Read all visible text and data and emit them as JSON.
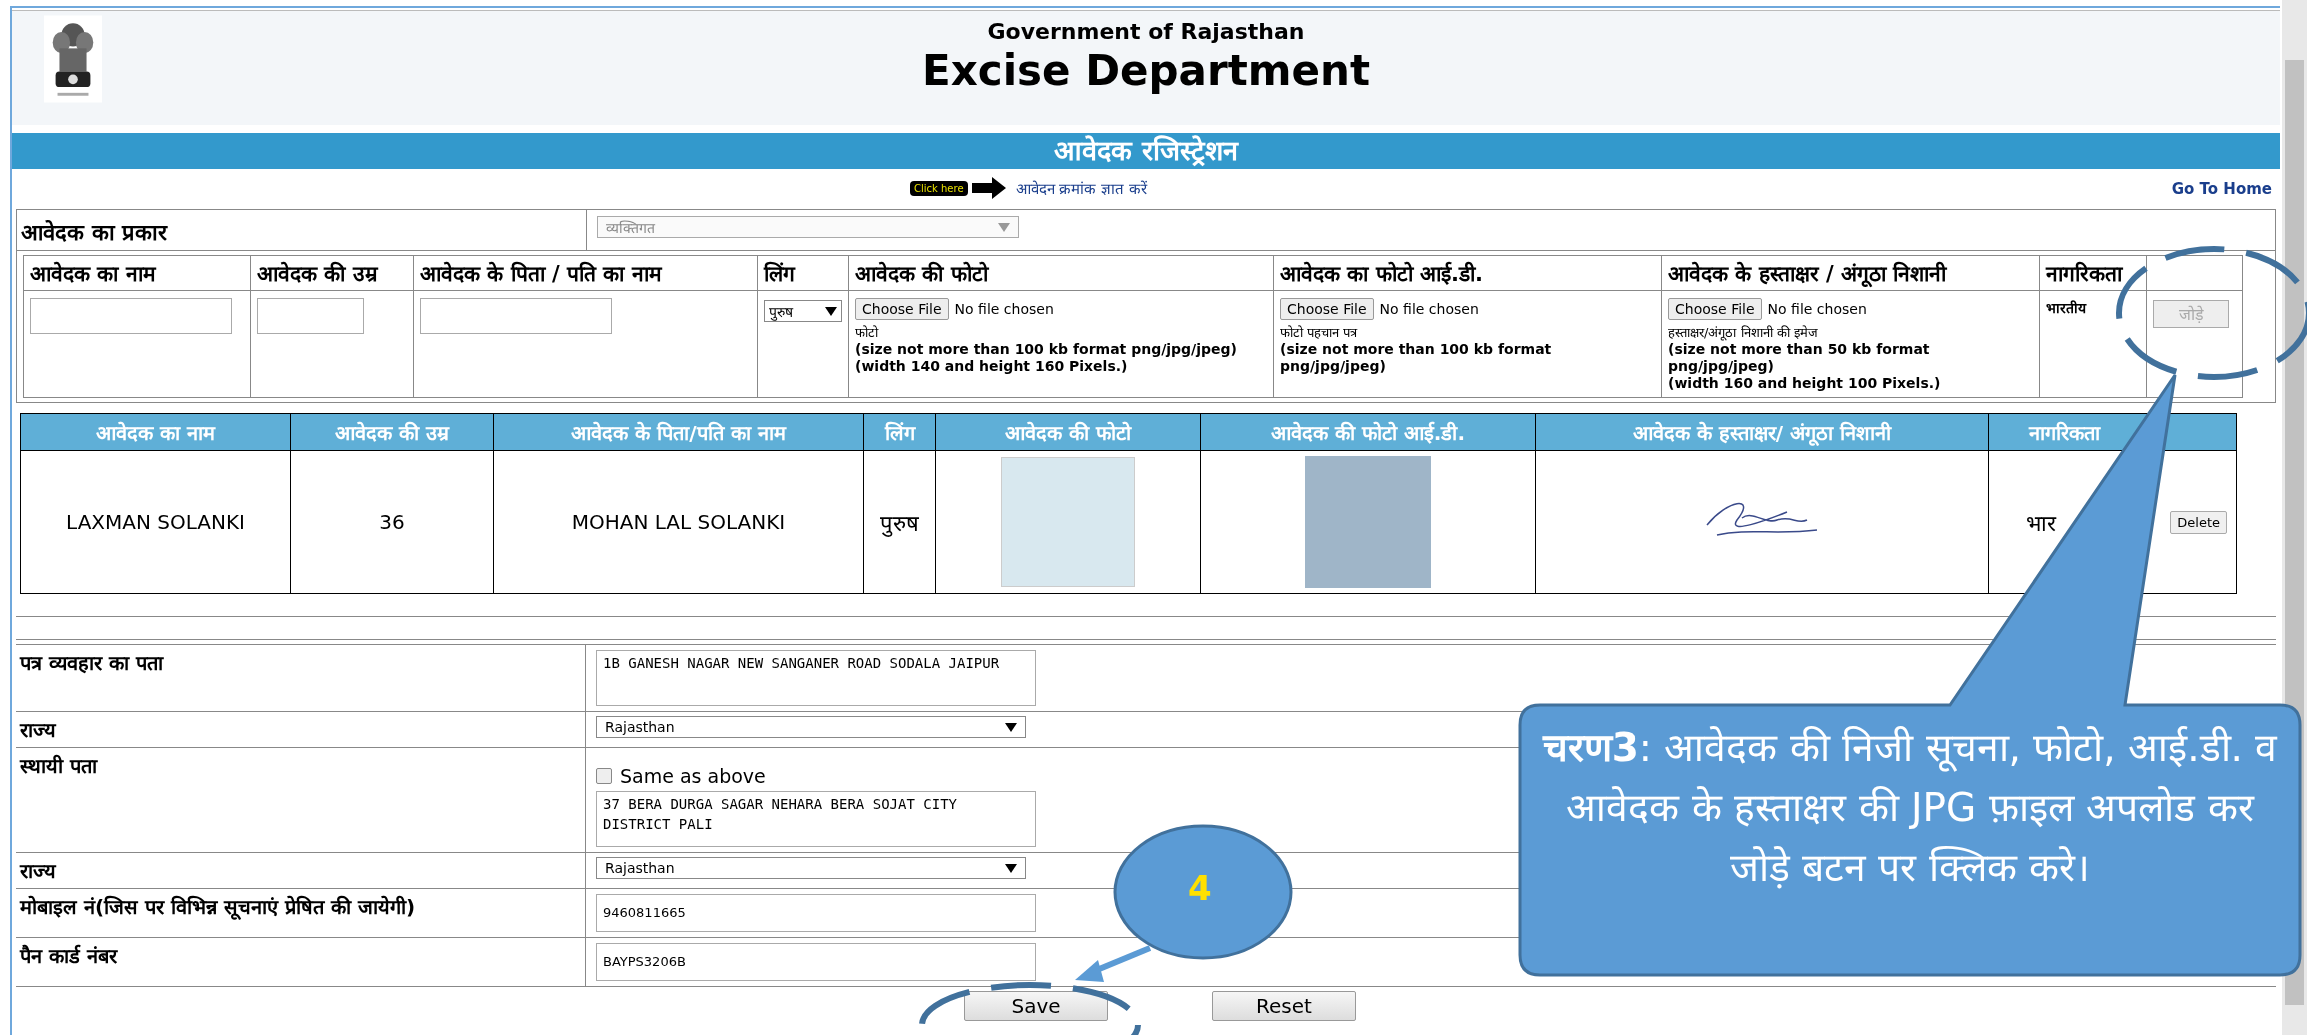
{
  "header": {
    "subtitle": "Government of Rajasthan",
    "title": "Excise Department"
  },
  "banner": "आवेदक रजिस्ट्रेशन",
  "links": {
    "click_badge": "Click here",
    "find_application": "आवेदन क्रमांक ज्ञात करें",
    "home": "Go To Home"
  },
  "applicant_type": {
    "label": "आवेदक का प्रकार",
    "value": "व्यक्तिगत",
    "disabled": true
  },
  "entry": {
    "columns": [
      "आवेदक का नाम",
      "आवेदक की उम्र",
      "आवेदक के पिता / पति का नाम",
      "लिंग",
      "आवेदक की फोटो",
      "आवेदक का फोटो आई.डी.",
      "आवेदक के हस्ताक्षर / अंगूठा निशानी",
      "नागरिकता"
    ],
    "gender": "पुरुष",
    "files": [
      {
        "button": "Choose File",
        "status": "No file chosen",
        "caption": "फोटो",
        "notes": [
          "(size not more than 100 kb format png/jpg/jpeg)",
          "(width 140 and height 160 Pixels.)"
        ]
      },
      {
        "button": "Choose File",
        "status": "No file chosen",
        "caption": "फोटो पहचान पत्र",
        "notes": [
          "(size not more than 100 kb format png/jpg/jpeg)"
        ]
      },
      {
        "button": "Choose File",
        "status": "No file chosen",
        "caption": "हस्ताक्षर/अंगूठा निशानी की इमेज",
        "notes": [
          "(size not more than 50 kb format png/jpg/jpeg)",
          "(width 160 and height 100 Pixels.)"
        ]
      }
    ],
    "citizenship": "भारतीय",
    "add_button": {
      "label": "जोड़े",
      "disabled": true
    }
  },
  "applicants": {
    "columns": [
      "आवेदक का नाम",
      "आवेदक की उम्र",
      "आवेदक के पिता/पति का नाम",
      "लिंग",
      "आवेदक की फोटो",
      "आवेदक की फोटो आई.डी.",
      "आवेदक के हस्ताक्षर/ अंगूठा निशानी",
      "नागरिकता"
    ],
    "rows": [
      {
        "name": "LAXMAN SOLANKI",
        "age": "36",
        "father": "MOHAN LAL SOLANKI",
        "gender": "पुरुष",
        "citizenship": "भार",
        "action": "Delete"
      }
    ]
  },
  "address_fields": [
    {
      "kind": "textarea",
      "label": "पत्र व्यवहार का पता",
      "value": "1B GANESH NAGAR NEW SANGANER ROAD SODALA JAIPUR"
    },
    {
      "kind": "select",
      "label": "राज्य",
      "value": "Rajasthan"
    },
    {
      "kind": "textarea",
      "label": "स्थायी पता",
      "checkbox": {
        "label": "Same as above",
        "checked": false
      },
      "value": "37 BERA DURGA SAGAR NEHARA BERA SOJAT CITY DISTRICT PALI"
    },
    {
      "kind": "select",
      "label": "राज्य",
      "value": "Rajasthan"
    },
    {
      "kind": "input",
      "label": "मोबाइल नं(जिस पर विभिन्न सूचनाएं प्रेषित की जायेगी)",
      "value": "9460811665"
    },
    {
      "kind": "input",
      "label": "पैन कार्ड नंबर",
      "value": "BAYPS3206B"
    }
  ],
  "buttons": [
    "Save",
    "Reset"
  ],
  "annotations": {
    "callout": "**चरण3**: आवेदक की निजी सूचना, फोटो, आई.डी. व आवेदक के हस्ताक्षर की JPG फ़ाइल अपलोड कर जोड़े बटन पर क्लिक करे।",
    "step_badge": "4"
  }
}
